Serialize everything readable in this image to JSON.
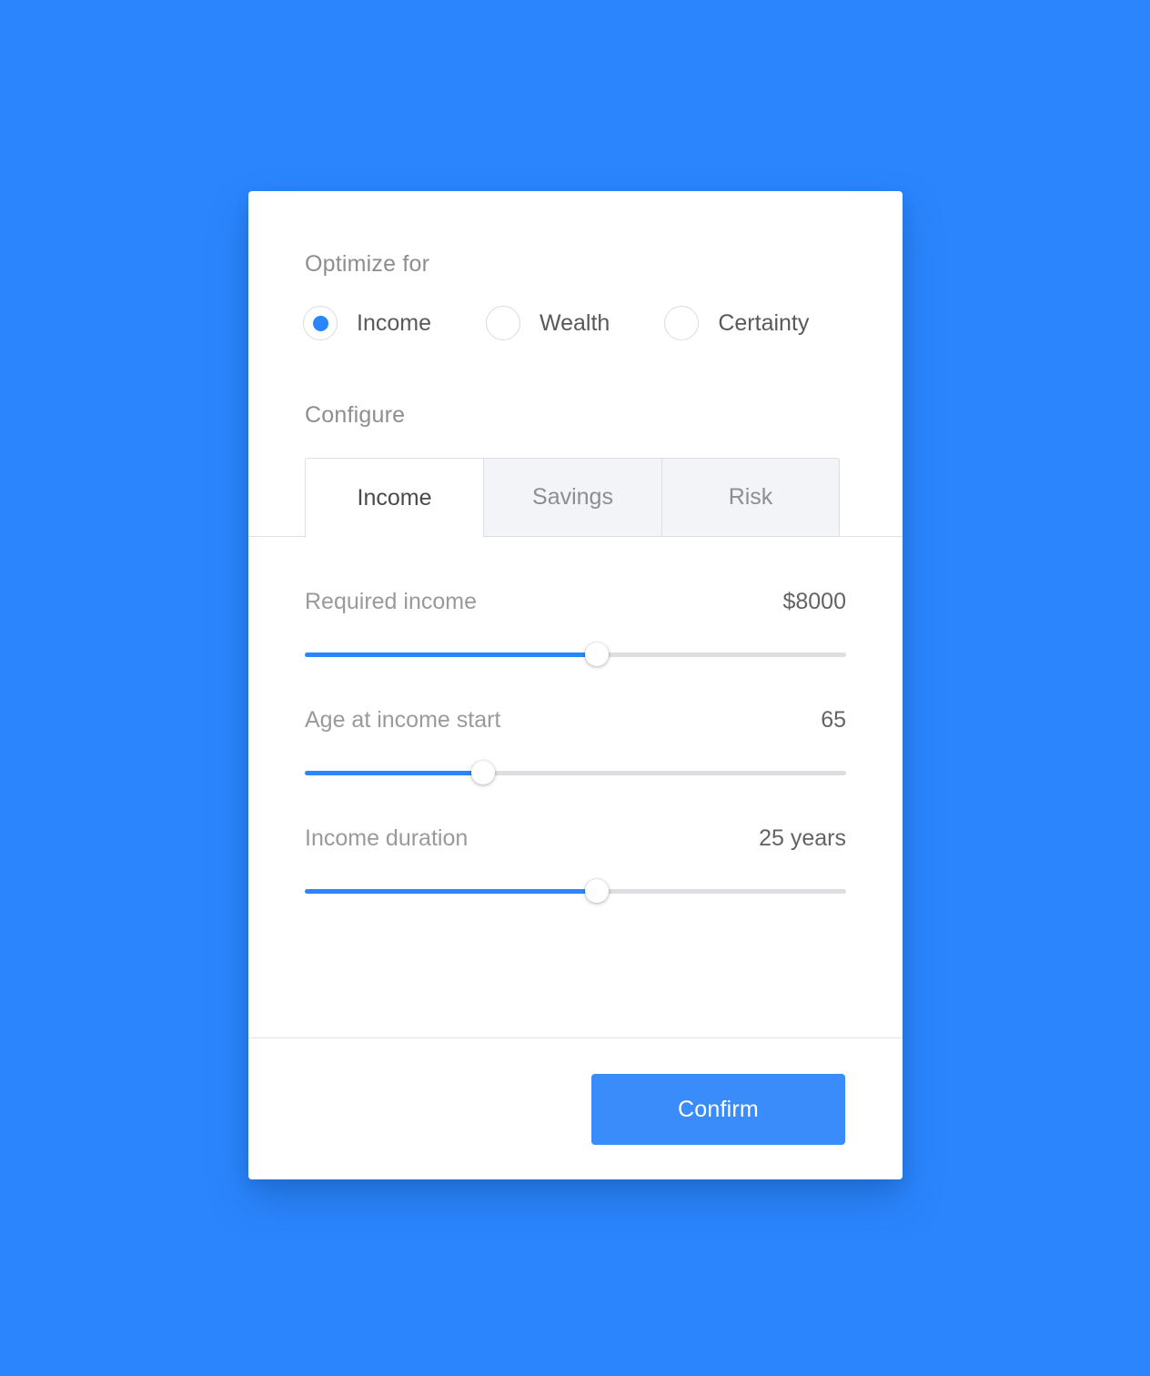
{
  "theme": {
    "background": "#2b86fe",
    "accent": "#2b86fe",
    "button": "#3b8cfb",
    "card": "#ffffff",
    "label_text": "#9a9a9c",
    "value_text": "#636365",
    "heading_text": "#8e8e8e",
    "track": "#dcdee2",
    "tab_inactive_bg": "#f2f4f7",
    "border": "#dfdfe1"
  },
  "optimize": {
    "heading": "Optimize for",
    "options": [
      {
        "label": "Income",
        "selected": true
      },
      {
        "label": "Wealth",
        "selected": false
      },
      {
        "label": "Certainty",
        "selected": false
      }
    ]
  },
  "configure": {
    "heading": "Configure",
    "tabs": [
      {
        "label": "Income",
        "active": true
      },
      {
        "label": "Savings",
        "active": false
      },
      {
        "label": "Risk",
        "active": false
      }
    ],
    "sliders": [
      {
        "label": "Required income",
        "value": "$8000",
        "percent": 54
      },
      {
        "label": "Age at income start",
        "value": "65",
        "percent": 33
      },
      {
        "label": "Income duration",
        "value": "25 years",
        "percent": 54
      }
    ]
  },
  "footer": {
    "confirm_label": "Confirm"
  }
}
